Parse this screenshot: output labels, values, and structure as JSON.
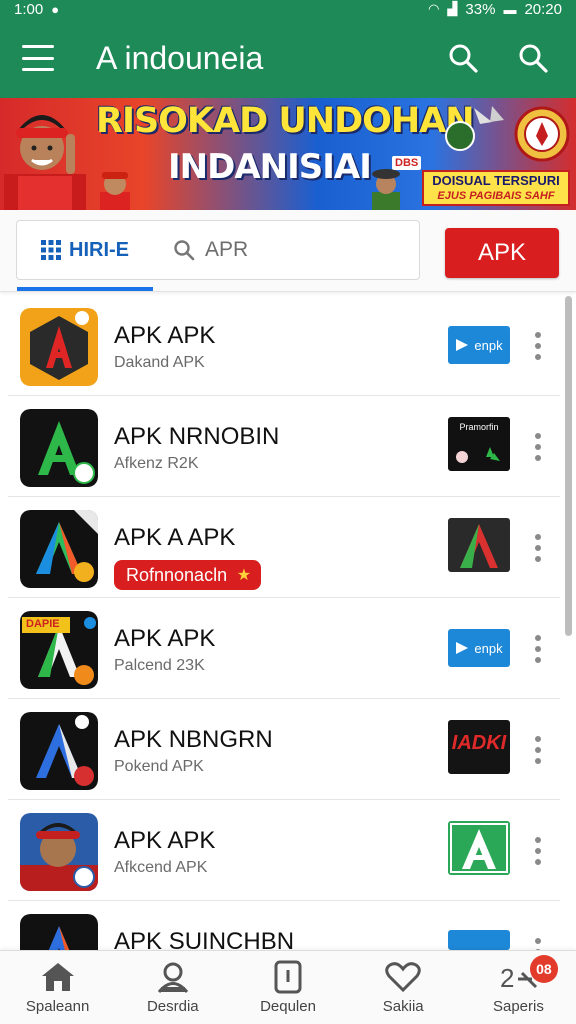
{
  "status_bar": {
    "time_left": "1:00",
    "battery": "33%",
    "time_right": "20:20"
  },
  "app_bar": {
    "title": "A indouneia"
  },
  "banner": {
    "headline": "RISOKAD UNDOHAN",
    "subheadline": "INDANISIAI",
    "small_tag": "DBS",
    "promo_title": "DOISUAL TERSPURI",
    "promo_sub": "EJUS PAGIBAIS SAHF"
  },
  "toolbar": {
    "home_tab_label": "HIRI-E",
    "search_placeholder": "APR",
    "apk_button_label": "APK"
  },
  "apps": [
    {
      "title": "APK APK",
      "subtitle": "Dakand APK",
      "badge_text": "enpk",
      "badge_kind": "blue"
    },
    {
      "title": "APK NRNOBIN",
      "subtitle": "Afkenz R2K",
      "badge_text": "Pramorfin",
      "badge_kind": "dark-plant"
    },
    {
      "title": "APK A APK",
      "promo_label": "Rofnnonacln",
      "badge_kind": "logo-a"
    },
    {
      "title": "APK APK",
      "subtitle": "Palcend 23K",
      "badge_text": "enpk",
      "badge_kind": "blue",
      "icon_tag": "DAPIE"
    },
    {
      "title": "APK NBNGRN",
      "subtitle": "Pokend APK",
      "badge_text": "IADKI",
      "badge_kind": "dark-red"
    },
    {
      "title": "APK APK",
      "subtitle": "Afkcend APK",
      "badge_kind": "green-a"
    },
    {
      "title": "APK SUINCHBN",
      "badge_kind": "blue"
    }
  ],
  "bottom_nav": [
    {
      "label": "Spaleann",
      "icon": "home-icon"
    },
    {
      "label": "Desrdia",
      "icon": "person-icon"
    },
    {
      "label": "Dequlen",
      "icon": "device-icon"
    },
    {
      "label": "Sakiia",
      "icon": "heart-icon"
    },
    {
      "label": "Saperis",
      "icon": "updates-icon",
      "badge": "08"
    }
  ],
  "colors": {
    "primary_green": "#1e8a57",
    "accent_red": "#d81e1e",
    "link_blue": "#1a73e8"
  }
}
